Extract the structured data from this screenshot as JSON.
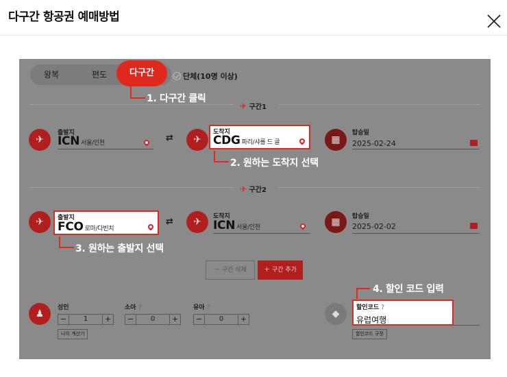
{
  "header": {
    "title": "다구간 항공권 예매방법"
  },
  "tabs": {
    "roundtrip": "왕복",
    "oneway": "편도",
    "multi": "다구간",
    "group": "단체(10명 이상)"
  },
  "annotations": {
    "step1": "1. 다구간 클릭",
    "step2": "2. 원하는 도착지 선택",
    "step3": "3. 원하는 출발지 선택",
    "step4": "4. 할인 코드 입력"
  },
  "segments": [
    {
      "label": "구간1",
      "origin": {
        "label": "출발지",
        "code": "ICN",
        "city": "서울/인천"
      },
      "destination": {
        "label": "도착지",
        "code": "CDG",
        "city": "파리/샤를 드 골"
      },
      "date": {
        "label": "탑승일",
        "value": "2025-02-24"
      }
    },
    {
      "label": "구간2",
      "origin": {
        "label": "출발지",
        "code": "FCO",
        "city": "로마/다빈치"
      },
      "destination": {
        "label": "도착지",
        "code": "ICN",
        "city": "서울/인천"
      },
      "date": {
        "label": "탑승일",
        "value": "2025-02-02"
      }
    }
  ],
  "segment_buttons": {
    "delete": "－ 구간 삭제",
    "add": "＋ 구간 추가"
  },
  "passengers": {
    "adult": {
      "label": "성인",
      "value": "1"
    },
    "child": {
      "label": "소아",
      "value": "0"
    },
    "infant": {
      "label": "유아",
      "value": "0"
    },
    "age_calc": "나이 계산기",
    "minus": "−",
    "plus": "+",
    "help": "?"
  },
  "discount": {
    "label": "할인코드",
    "value": "유럽여행",
    "rules": "할인코드 규정"
  }
}
